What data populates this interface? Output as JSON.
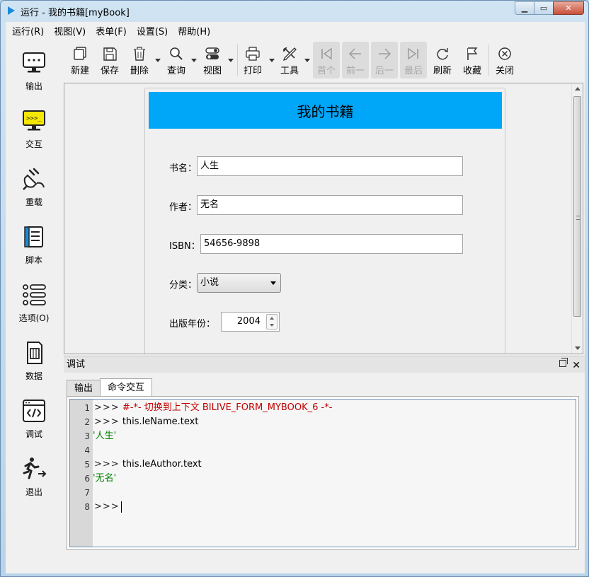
{
  "window": {
    "title": "运行 - 我的书籍[myBook]"
  },
  "menubar": {
    "items": [
      {
        "label": "运行(R)"
      },
      {
        "label": "视图(V)"
      },
      {
        "label": "表单(F)"
      },
      {
        "label": "设置(S)"
      },
      {
        "label": "帮助(H)"
      }
    ]
  },
  "sidebar": {
    "items": [
      {
        "label": "输出",
        "icon": "monitor-icon"
      },
      {
        "label": "交互",
        "icon": "terminal-icon"
      },
      {
        "label": "重载",
        "icon": "plug-icon"
      },
      {
        "label": "脚本",
        "icon": "book-icon"
      },
      {
        "label": "选项(O)",
        "icon": "list-icon"
      },
      {
        "label": "数据",
        "icon": "chip-icon"
      },
      {
        "label": "调试",
        "icon": "code-window-icon"
      },
      {
        "label": "退出",
        "icon": "exit-runner-icon"
      }
    ]
  },
  "toolbar": {
    "new": "新建",
    "save": "保存",
    "delete": "删除",
    "query": "查询",
    "view": "视图",
    "print": "打印",
    "tools": "工具",
    "first": "首个",
    "prev": "前一",
    "next": "后一",
    "last": "最后",
    "refresh": "刷新",
    "favorite": "收藏",
    "close": "关闭"
  },
  "form": {
    "title": "我的书籍",
    "name_label": "书名：",
    "name_value": "人生",
    "author_label": "作者：",
    "author_value": "无名",
    "isbn_label": "ISBN：",
    "isbn_value": "54656-9898",
    "category_label": "分类：",
    "category_value": "小说",
    "year_label": "出版年份：",
    "year_value": "2004"
  },
  "debug": {
    "title": "调试",
    "tabs": [
      {
        "label": "输出",
        "active": false
      },
      {
        "label": "命令交互",
        "active": true
      }
    ],
    "lines": [
      {
        "num": "1",
        "prompt": ">>>",
        "text": "#-*- 切换到上下文 BILIVE_FORM_MYBOOK_6 -*-",
        "kind": "comment"
      },
      {
        "num": "2",
        "prompt": ">>>",
        "text": "this.leName.text",
        "kind": "code"
      },
      {
        "num": "3",
        "prompt": "",
        "text": "'人生'",
        "kind": "string"
      },
      {
        "num": "4",
        "prompt": "",
        "text": "",
        "kind": "code"
      },
      {
        "num": "5",
        "prompt": ">>>",
        "text": "this.leAuthor.text",
        "kind": "code"
      },
      {
        "num": "6",
        "prompt": "",
        "text": "'无名'",
        "kind": "string"
      },
      {
        "num": "7",
        "prompt": "",
        "text": "",
        "kind": "code"
      },
      {
        "num": "8",
        "prompt": ">>>",
        "text": "",
        "kind": "code"
      }
    ]
  },
  "colors": {
    "form_header": "#00a6f8",
    "comment": "#c00000",
    "string": "#008000"
  }
}
